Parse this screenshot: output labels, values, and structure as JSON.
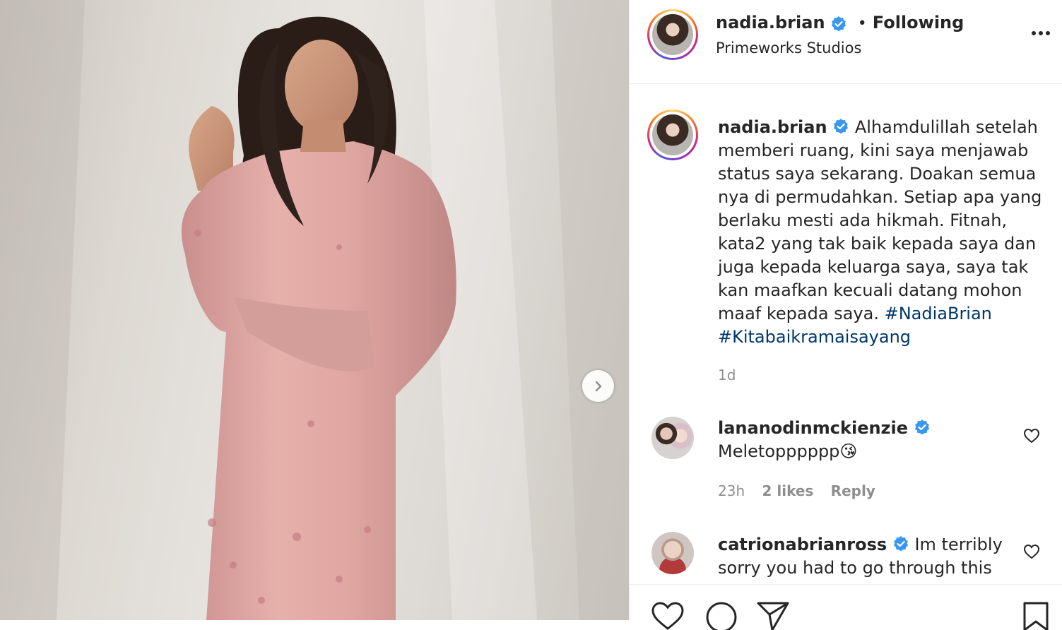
{
  "post": {
    "author": "nadia.brian",
    "follow_separator": "•",
    "follow_status": "Following",
    "location": "Primeworks Studios",
    "caption_parts": [
      {
        "text": "Alhamdulillah setelah",
        "hashtag": false
      },
      {
        "text": "memberi ruang, kini saya menjawab",
        "hashtag": false
      },
      {
        "text": "status saya sekarang. Doakan semua",
        "hashtag": false
      },
      {
        "text": "nya di permudahkan. Setiap apa yang",
        "hashtag": false
      },
      {
        "text": "berlaku mesti ada hikmah. Fitnah,",
        "hashtag": false
      },
      {
        "text": "kata2 yang tak baik kepada saya dan",
        "hashtag": false
      },
      {
        "text": "juga kepada keluarga saya, saya tak",
        "hashtag": false
      },
      {
        "text": "kan maafkan kecuali datang mohon",
        "hashtag": false
      },
      {
        "text": "maaf kepada saya.",
        "hashtag": false
      },
      {
        "text": "#NadiaBrian",
        "hashtag": true
      },
      {
        "text": "#Kitabaikramaisayang",
        "hashtag": true
      }
    ],
    "timestamp": "1d"
  },
  "comments": [
    {
      "username": "lananodinmckienzie",
      "text": "Meletopppppp😘",
      "time": "23h",
      "likes": "2 likes",
      "reply": "Reply"
    },
    {
      "username": "catrionabrianross",
      "text_line1": "Im terribly",
      "text_line2": "sorry you had to go through this"
    }
  ],
  "icons": {
    "more": "more-options-icon",
    "verified": "verified-badge-icon",
    "next": "chevron-right-icon",
    "heart": "heart-icon",
    "comment": "comment-icon",
    "share": "share-icon",
    "save": "bookmark-icon"
  },
  "colors": {
    "verified": "#3897f0",
    "hashtag": "#00376b",
    "muted": "#8e8e8e",
    "dress": "#dfa7a3"
  }
}
